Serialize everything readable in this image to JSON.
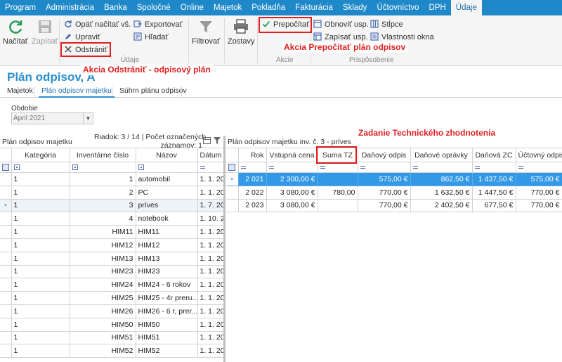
{
  "menu": [
    "Program",
    "Administrácia",
    "Banka",
    "Spoločné",
    "Online",
    "Majetok",
    "Pokladňa",
    "Fakturácia",
    "Sklady",
    "Účtovníctvo",
    "DPH",
    "Údaje"
  ],
  "ribbon": {
    "nacitat": "Načítať",
    "zapisat": "Zapísať",
    "opat_nacitat": "Opäť načítať vš.",
    "upravit": "Upraviť",
    "odstranit": "Odstrániť",
    "exportovat": "Exportovať",
    "hladat": "Hľadať",
    "filtrovat": "Filtrovať",
    "zostavy": "Zostavy",
    "prepocitat": "Prepočítať",
    "obnovit": "Obnoviť usp.",
    "zapisat_usp": "Zapísať usp.",
    "stlpce": "Stĺpce",
    "vlastnosti": "Vlastnosti okna",
    "group_udaje": "Údaje",
    "group_akcie": "Akcie",
    "group_prisp": "Prispôsobenie"
  },
  "page_title": "Plán odpisov, A",
  "tabs": [
    "Majetok",
    "Plán odpisov majetku",
    "Súhrn plánu odpisov"
  ],
  "period": {
    "label": "Obdobie",
    "value": "April 2021"
  },
  "left_panel": {
    "title": "Plán odpisov majetku",
    "record_info_1": "Riadok: 3 / 14 | Počet označených",
    "record_info_2": "záznamov: 1",
    "columns": [
      "Kategória",
      "Inventárne číslo",
      "Názov",
      "Dátum"
    ],
    "rows": [
      [
        "1",
        "1",
        "automobil",
        "1. 1. 202"
      ],
      [
        "1",
        "2",
        "PC",
        "1. 1. 202"
      ],
      [
        "1",
        "3",
        "príves",
        "1. 7. 202"
      ],
      [
        "1",
        "4",
        "notebook",
        "1. 10. 20"
      ],
      [
        "1",
        "HIM11",
        "HIM11",
        "1. 1. 202"
      ],
      [
        "1",
        "HIM12",
        "HIM12",
        "1. 1. 202"
      ],
      [
        "1",
        "HIM13",
        "HIM13",
        "1. 1. 202"
      ],
      [
        "1",
        "HIM23",
        "HIM23",
        "1. 1. 202"
      ],
      [
        "1",
        "HIM24",
        "HIM24 - 6 rokov",
        "1. 1. 202"
      ],
      [
        "1",
        "HIM25",
        "HIM25 - 4r preru...",
        "1. 1. 202"
      ],
      [
        "1",
        "HIM26",
        "HIM26 - 6 r, prer...",
        "1. 1. 202"
      ],
      [
        "1",
        "HIM50",
        "HIM50",
        "1. 1. 202"
      ],
      [
        "1",
        "HIM51",
        "HIM51",
        "1. 1. 202"
      ],
      [
        "1",
        "HIM52",
        "HIM52",
        "1. 1. 202"
      ]
    ]
  },
  "right_panel": {
    "title": "Plán odpisov majetku inv. č. 3 - príves",
    "columns": [
      "Rok",
      "Vstupná cena",
      "Suma TZ",
      "Daňový odpis",
      "Daňové oprávky",
      "Daňová ZC",
      "Účtovný odpis"
    ],
    "rows": [
      [
        "2 021",
        "2 300,00 €",
        "",
        "575,00 €",
        "862,50 €",
        "1 437,50 €",
        "575,00 €"
      ],
      [
        "2 022",
        "3 080,00 €",
        "780,00",
        "770,00 €",
        "1 632,50 €",
        "1 447,50 €",
        "770,00 €"
      ],
      [
        "2 023",
        "3 080,00 €",
        "",
        "770,00 €",
        "2 402,50 €",
        "677,50 €",
        "770,00 €"
      ]
    ]
  },
  "annotations": {
    "odstranit": "Akcia Odstrániť - odpisový plán",
    "prepocitat": "Akcia Prepočítať plán odpisov",
    "zadanie": "Zadanie Technického zhodnotenia"
  }
}
